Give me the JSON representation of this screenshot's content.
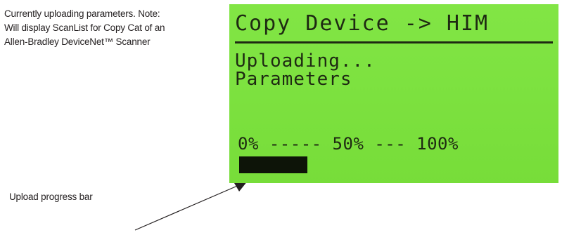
{
  "annotations": {
    "note_lines": [
      "Currently uploading parameters. Note:",
      "Will display ScanList for Copy Cat of an",
      "Allen-Bradley DeviceNet™ Scanner"
    ],
    "progress_label": "Upload progress bar"
  },
  "lcd": {
    "title": "Copy Device -> HIM",
    "status_line1": "Uploading...",
    "status_line2": "Parameters",
    "scale_text": "0% ----- 50% --- 100%",
    "progress_fraction": 0.22
  },
  "colors": {
    "lcd_background": "#7be43b",
    "lcd_text": "#1e2a12",
    "progress_fill": "#0d1408",
    "annotation_text": "#231f20"
  }
}
